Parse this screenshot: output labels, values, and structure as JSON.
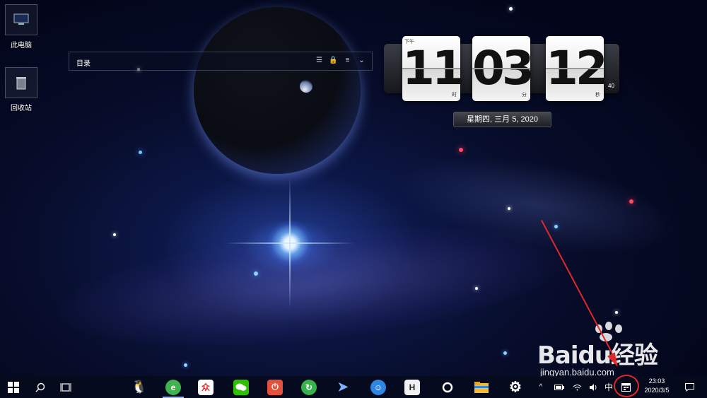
{
  "desktop": {
    "icons": [
      {
        "label": "此电脑",
        "icon": "computer-icon"
      },
      {
        "label": "回收站",
        "icon": "recycle-bin-icon"
      }
    ]
  },
  "toolbar": {
    "title": "目录",
    "tools": [
      "list-icon",
      "lock-icon",
      "menu-icon",
      "chevron-down-icon"
    ]
  },
  "flip_clock": {
    "ampm": "下午",
    "hour": "11",
    "minute": "03",
    "second": "12",
    "hour_unit": "时",
    "minute_unit": "分",
    "second_unit": "秒",
    "small_seconds": "40",
    "date": "星期四, 三月 5, 2020"
  },
  "watermark": {
    "brand": "Baidu经验",
    "url": "jingyan.baidu.com"
  },
  "taskbar": {
    "start": "windows-start-icon",
    "search": "search-icon",
    "task_view": "task-view-icon",
    "apps": [
      {
        "name": "qq",
        "icon": "qq-penguin-icon",
        "glyph": "🐧",
        "color": "#000000"
      },
      {
        "name": "browser",
        "icon": "browser-e-icon",
        "glyph": "e",
        "color": "#3fb34f"
      },
      {
        "name": "app-red",
        "icon": "red-app-icon",
        "glyph": "众",
        "color": "#d92b2b"
      },
      {
        "name": "wechat",
        "icon": "wechat-icon",
        "glyph": "●",
        "color": "#2dc100"
      },
      {
        "name": "power",
        "icon": "power-app-icon",
        "glyph": "⏻",
        "color": "#e2513b"
      },
      {
        "name": "refresh",
        "icon": "green-refresh-icon",
        "glyph": "↻",
        "color": "#36b34a"
      },
      {
        "name": "feishu",
        "icon": "paper-plane-icon",
        "glyph": "➤",
        "color": "#4b7fe6"
      },
      {
        "name": "penguin-blue",
        "icon": "blue-penguin-icon",
        "glyph": "☺",
        "color": "#2f86e0"
      },
      {
        "name": "h-app",
        "icon": "h-app-icon",
        "glyph": "H",
        "color": "#f0f0f0"
      },
      {
        "name": "circle",
        "icon": "circle-icon",
        "glyph": "○",
        "color": "#000000"
      },
      {
        "name": "explorer",
        "icon": "folder-icon",
        "glyph": "▬",
        "color": "#f2b93b"
      },
      {
        "name": "settings",
        "icon": "gear-icon",
        "glyph": "⚙",
        "color": "#000000"
      }
    ],
    "tray": {
      "chevron": "^",
      "ime": "中",
      "time": "23:03",
      "date": "2020/3/5"
    }
  }
}
